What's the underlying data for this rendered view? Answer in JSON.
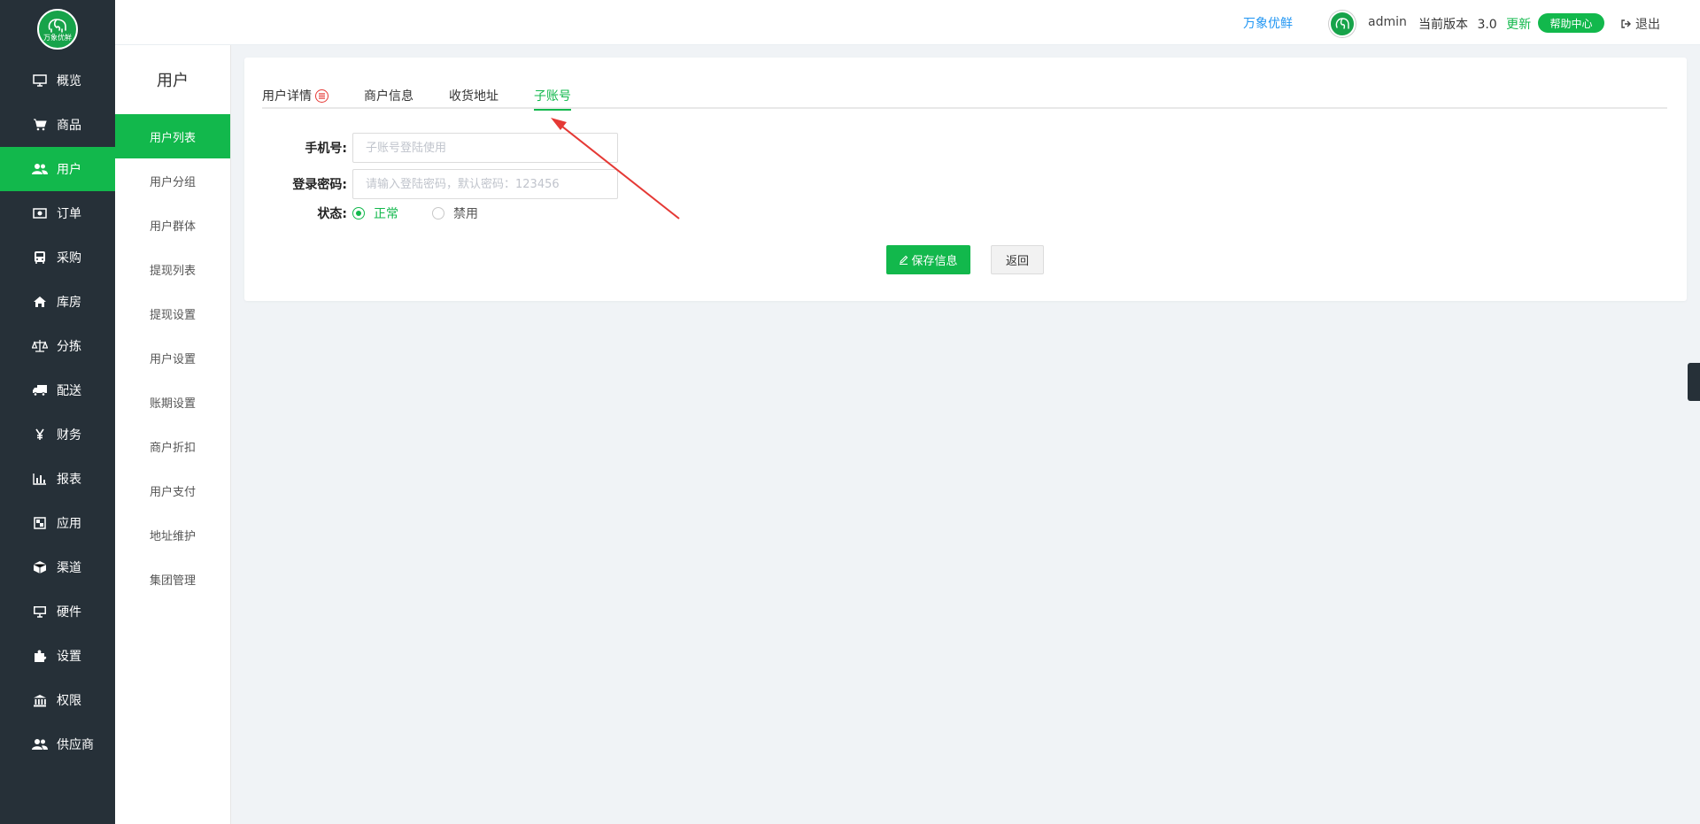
{
  "logo": {
    "text": "万象优鲜"
  },
  "nav": [
    {
      "label": "概览",
      "icon": "monitor-icon"
    },
    {
      "label": "商品",
      "icon": "cart-icon"
    },
    {
      "label": "用户",
      "icon": "users-icon",
      "active": true
    },
    {
      "label": "订单",
      "icon": "money-icon"
    },
    {
      "label": "采购",
      "icon": "bus-icon"
    },
    {
      "label": "库房",
      "icon": "home-icon"
    },
    {
      "label": "分拣",
      "icon": "scale-icon"
    },
    {
      "label": "配送",
      "icon": "truck-icon"
    },
    {
      "label": "财务",
      "icon": "yen-icon"
    },
    {
      "label": "报表",
      "icon": "bar-chart-icon"
    },
    {
      "label": "应用",
      "icon": "apps-icon"
    },
    {
      "label": "渠道",
      "icon": "cube-icon"
    },
    {
      "label": "硬件",
      "icon": "desktop-icon"
    },
    {
      "label": "设置",
      "icon": "puzzle-icon"
    },
    {
      "label": "权限",
      "icon": "bank-icon"
    },
    {
      "label": "供应商",
      "icon": "group-icon"
    }
  ],
  "submenu": {
    "title": "用户",
    "items": [
      {
        "label": "用户列表",
        "active": true
      },
      {
        "label": "用户分组"
      },
      {
        "label": "用户群体"
      },
      {
        "label": "提现列表"
      },
      {
        "label": "提现设置"
      },
      {
        "label": "用户设置"
      },
      {
        "label": "账期设置"
      },
      {
        "label": "商户折扣"
      },
      {
        "label": "用户支付"
      },
      {
        "label": "地址维护"
      },
      {
        "label": "集团管理"
      }
    ]
  },
  "header": {
    "brand": "万象优鲜",
    "user": "admin",
    "version_label": "当前版本",
    "version": "3.0",
    "update": "更新",
    "help": "帮助中心",
    "logout": "退出"
  },
  "tabs": [
    {
      "label": "用户详情",
      "badge": true
    },
    {
      "label": "商户信息"
    },
    {
      "label": "收货地址"
    },
    {
      "label": "子账号",
      "active": true
    }
  ],
  "form": {
    "phone_label": "手机号:",
    "phone_placeholder": "子账号登陆使用",
    "phone_value": "",
    "password_label": "登录密码:",
    "password_placeholder": "请输入登陆密码，默认密码：123456",
    "password_value": "",
    "status_label": "状态:",
    "status_options": [
      "正常",
      "禁用"
    ],
    "status_selected": "正常"
  },
  "actions": {
    "save": "保存信息",
    "back": "返回"
  },
  "colors": {
    "accent": "#12b84c",
    "sidebar": "#263038",
    "brand_link": "#2196f3",
    "arrow": "#e53935"
  }
}
